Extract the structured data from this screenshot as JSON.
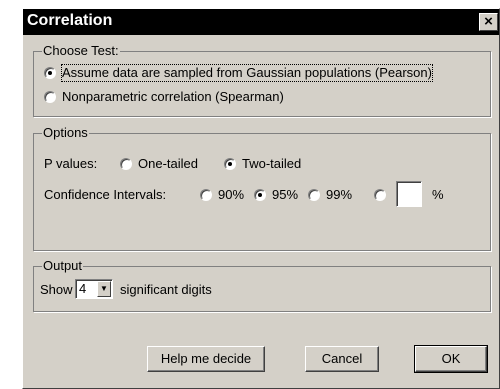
{
  "window": {
    "title": "Correlation",
    "close_glyph": "×"
  },
  "choose_test": {
    "legend": "Choose Test:",
    "pearson": {
      "label": "Assume data are sampled from Gaussian populations (Pearson)",
      "selected": true
    },
    "spearman": {
      "label": "Nonparametric correlation (Spearman)",
      "selected": false
    }
  },
  "options": {
    "legend": "Options",
    "p_values_label": "P values:",
    "one_tailed": {
      "label": "One-tailed",
      "selected": false
    },
    "two_tailed": {
      "label": "Two-tailed",
      "selected": true
    },
    "ci_label": "Confidence Intervals:",
    "ci_90": {
      "label": "90%",
      "selected": false
    },
    "ci_95": {
      "label": "95%",
      "selected": true
    },
    "ci_99": {
      "label": "99%",
      "selected": false
    },
    "ci_custom": {
      "value": "",
      "selected": false
    },
    "ci_custom_suffix": "%"
  },
  "output": {
    "legend": "Output",
    "show_label": "Show",
    "digits_value": "4",
    "digits_suffix": "significant digits"
  },
  "buttons": {
    "help": "Help me decide",
    "cancel": "Cancel",
    "ok": "OK"
  }
}
